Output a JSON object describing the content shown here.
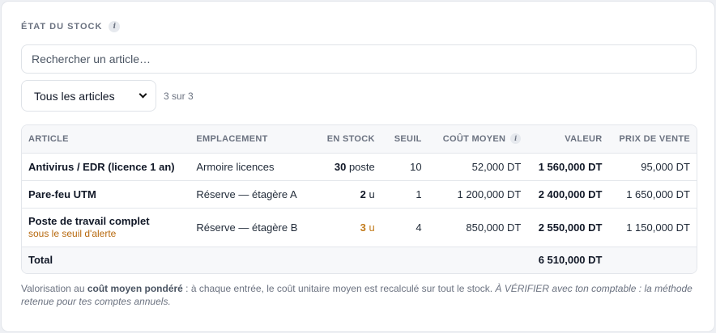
{
  "panel": {
    "title": "ÉTAT DU STOCK",
    "info_icon": "info-icon"
  },
  "search": {
    "placeholder": "Rechercher un article…",
    "value": ""
  },
  "filter": {
    "selected": "Tous les articles"
  },
  "result_count": "3 sur 3",
  "table": {
    "headers": {
      "article": "ARTICLE",
      "location": "EMPLACEMENT",
      "in_stock": "EN STOCK",
      "threshold": "SEUIL",
      "avg_cost": "COÛT MOYEN",
      "value": "VALEUR",
      "sale_price": "PRIX DE VENTE"
    },
    "rows": [
      {
        "article": "Antivirus / EDR (licence 1 an)",
        "alert": "",
        "location": "Armoire licences",
        "qty": "30",
        "unit": "poste",
        "threshold": "10",
        "avg_cost": "52,000 DT",
        "value": "1 560,000 DT",
        "sale_price": "95,000 DT"
      },
      {
        "article": "Pare-feu UTM",
        "alert": "",
        "location": "Réserve — étagère A",
        "qty": "2",
        "unit": "u",
        "threshold": "1",
        "avg_cost": "1 200,000 DT",
        "value": "2 400,000 DT",
        "sale_price": "1 650,000 DT"
      },
      {
        "article": "Poste de travail complet",
        "alert": "sous le seuil d'alerte",
        "location": "Réserve — étagère B",
        "qty": "3",
        "unit": "u",
        "threshold": "4",
        "avg_cost": "850,000 DT",
        "value": "2 550,000 DT",
        "sale_price": "1 150,000 DT"
      }
    ],
    "total": {
      "label": "Total",
      "value": "6 510,000 DT"
    }
  },
  "note": {
    "prefix": "Valorisation au ",
    "bold": "coût moyen pondéré",
    "middle": " : à chaque entrée, le coût unitaire moyen est recalculé sur tout le stock. ",
    "italic": "À VÉRIFIER avec ton comptable : la méthode retenue pour tes comptes annuels."
  },
  "colors": {
    "alert": "#b7690e",
    "muted": "#6b7280",
    "border": "#e3e6eb"
  }
}
